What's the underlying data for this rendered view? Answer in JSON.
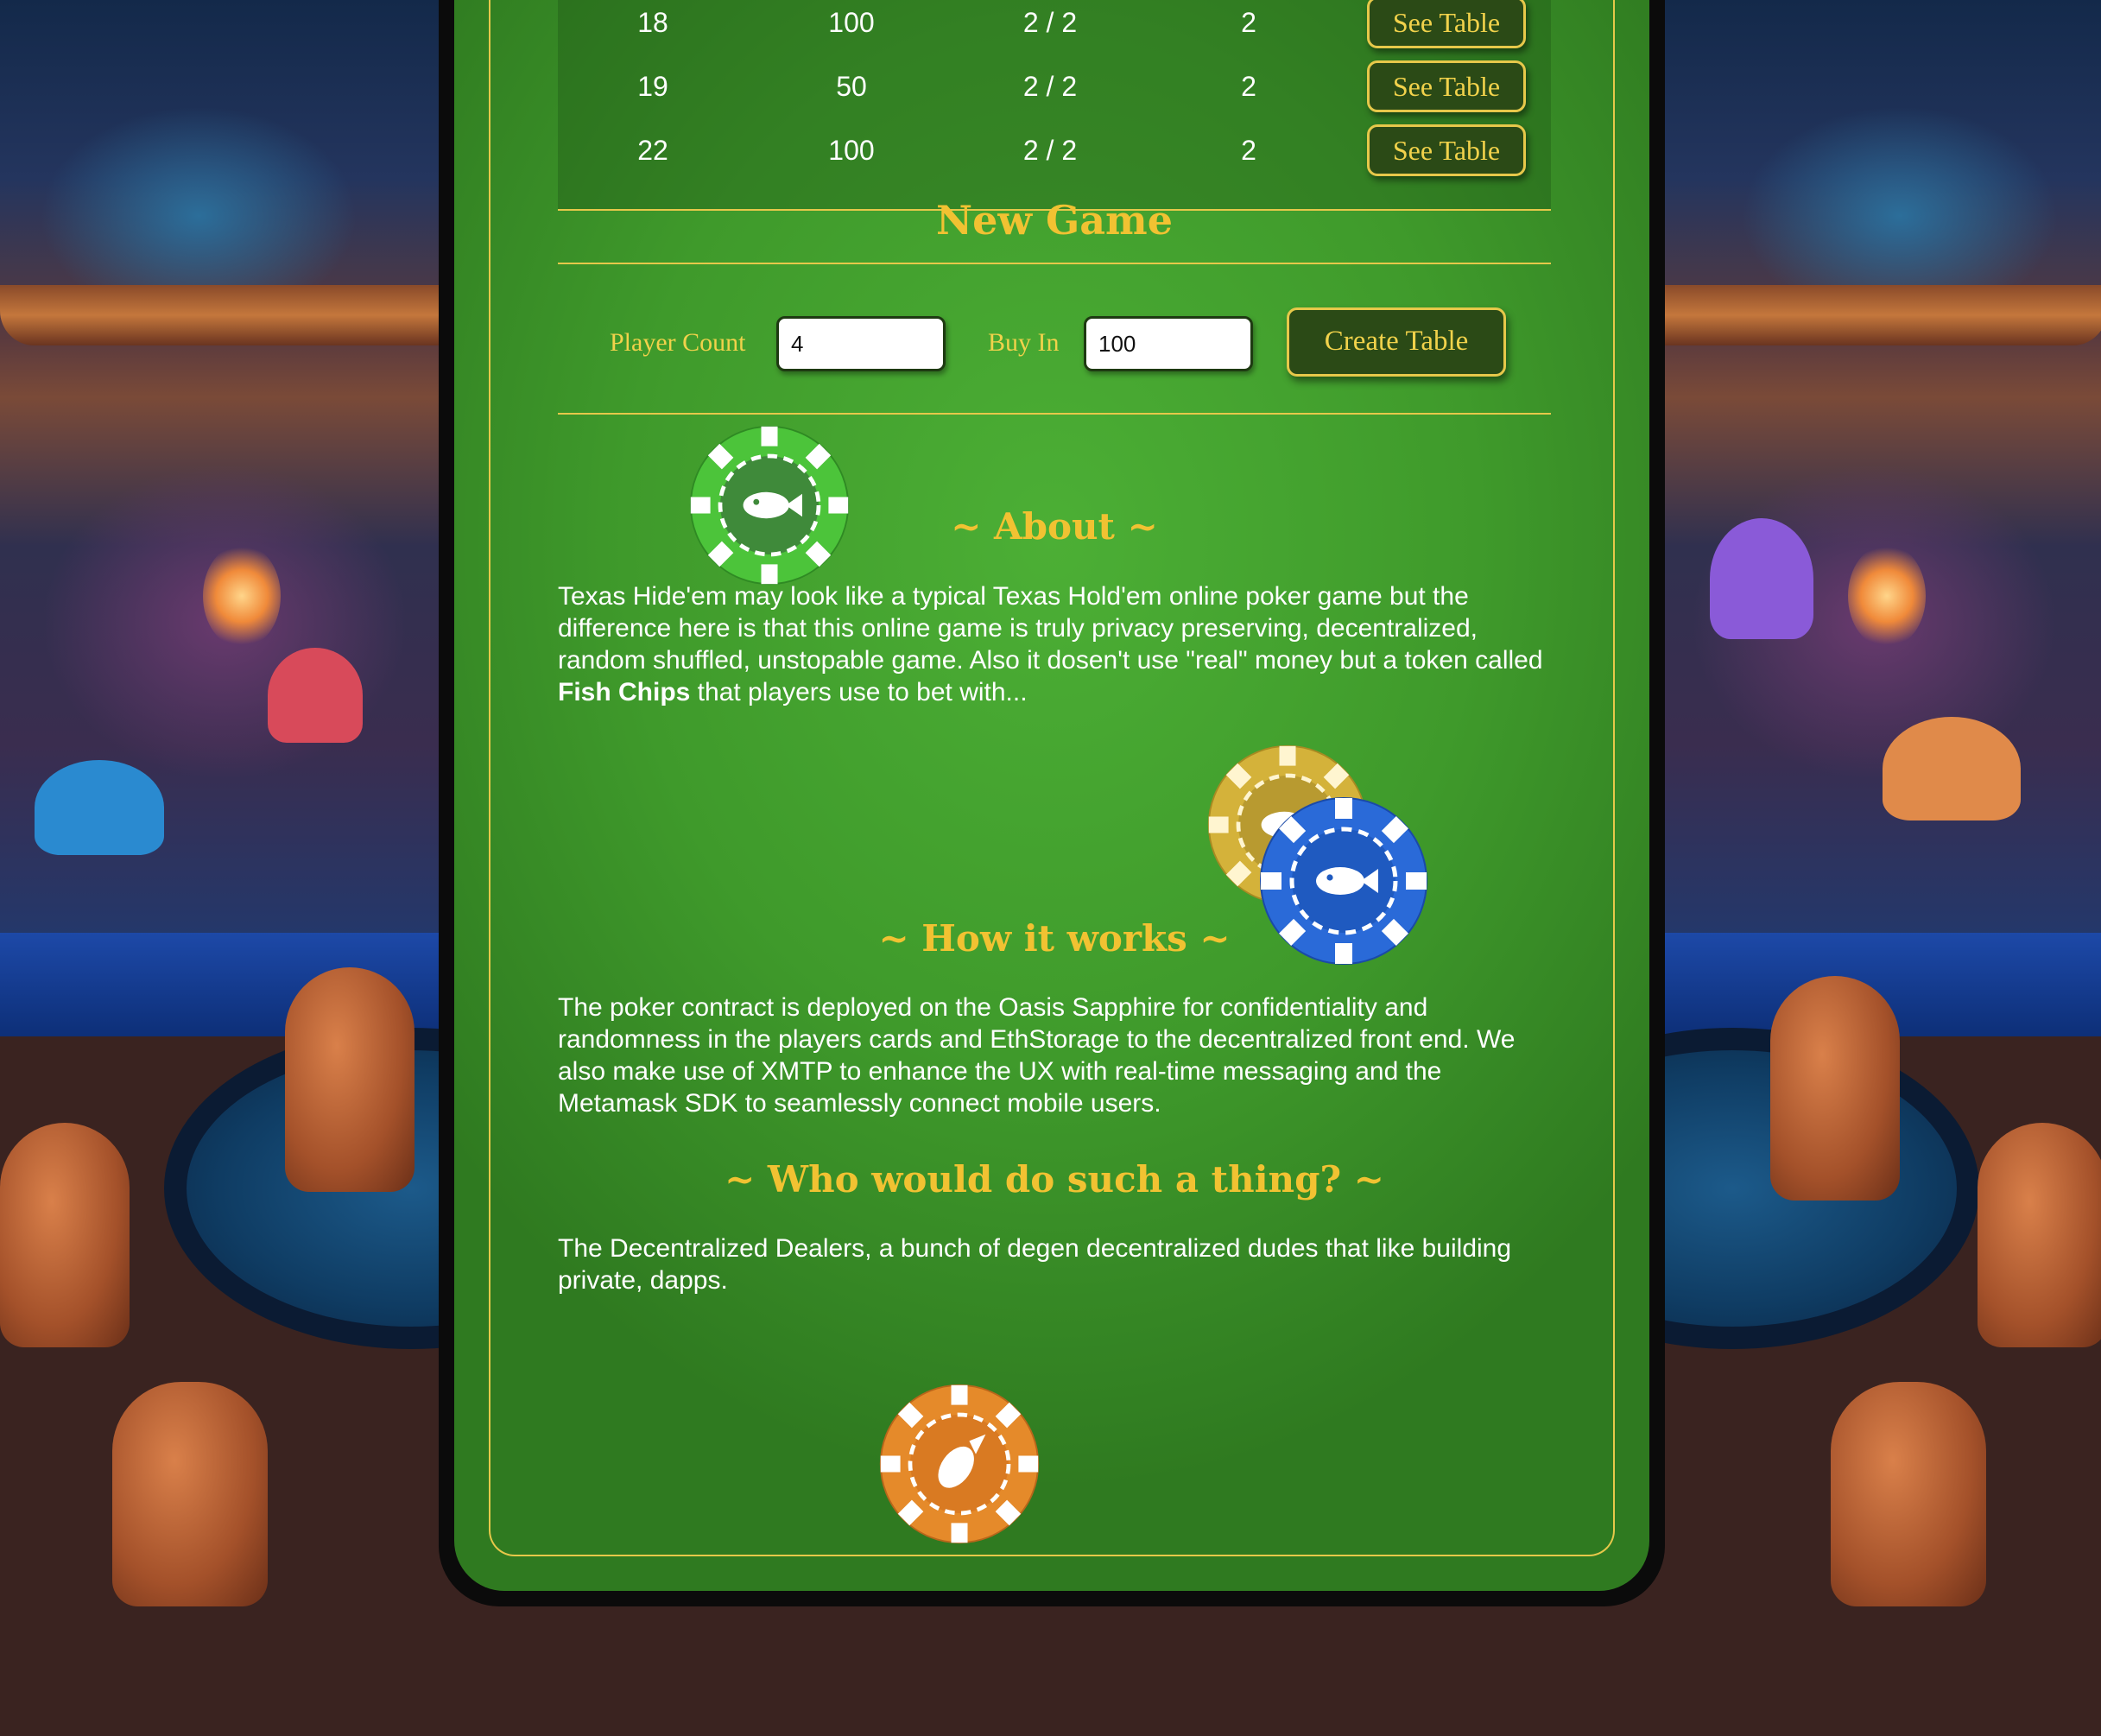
{
  "tables": {
    "rows": [
      {
        "id": "18",
        "buy_in": "100",
        "players": "2 / 2",
        "count": "2",
        "action": "See Table"
      },
      {
        "id": "19",
        "buy_in": "50",
        "players": "2 / 2",
        "count": "2",
        "action": "See Table"
      },
      {
        "id": "22",
        "buy_in": "100",
        "players": "2 / 2",
        "count": "2",
        "action": "See Table"
      }
    ]
  },
  "new_game": {
    "title": "New Game",
    "player_count_label": "Player Count",
    "player_count_value": "4",
    "buy_in_label": "Buy In",
    "buy_in_value": "100",
    "create_label": "Create Table"
  },
  "about": {
    "title": "~ About ~",
    "text_before": "Texas Hide'em may look like a typical Texas Hold'em online poker game but the difference here is that this online game is truly privacy preserving, decentralized, random shuffled, unstopable game. Also it dosen't use \"real\" money but a token called ",
    "token_name": "Fish Chips",
    "text_after": " that players use to bet with..."
  },
  "how_it_works": {
    "title": "~ How it works ~",
    "text": "The poker contract is deployed on the Oasis Sapphire for confidentiality and randomness in the players cards and EthStorage to the decentralized front end. We also make use of XMTP to enhance the UX with real-time messaging and the Metamask SDK to seamlessly connect mobile users."
  },
  "who": {
    "title": "~ Who would do such a thing? ~",
    "text": "The Decentralized Dealers, a bunch of degen decentralized dudes that like building private, dapps."
  },
  "chips": {
    "green": {
      "icon": "fish-chip-icon",
      "color": "#4cc43a"
    },
    "gold": {
      "icon": "fish-chip-icon",
      "color": "#d4b23a"
    },
    "blue": {
      "icon": "fish-chip-icon",
      "color": "#2a6ad8"
    },
    "orange": {
      "icon": "fish-chip-icon",
      "color": "#e58a2a"
    }
  },
  "colors": {
    "accent": "#f1c232",
    "felt": "#3f9a2b",
    "button": "#2b4a16"
  }
}
